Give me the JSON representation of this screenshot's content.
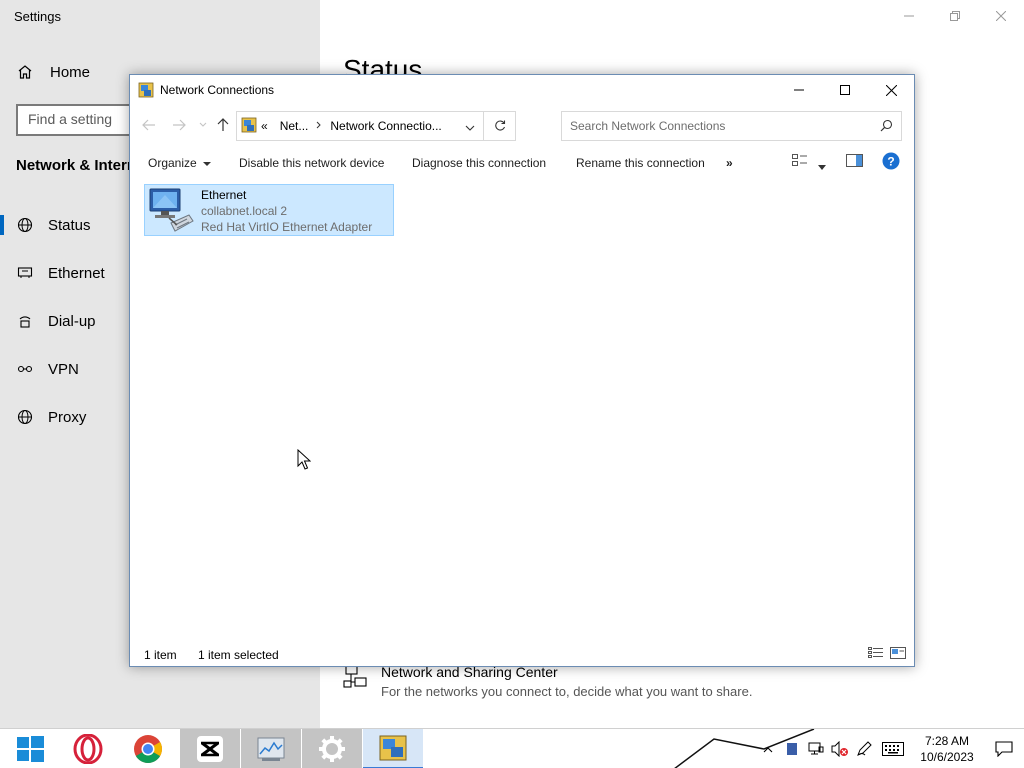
{
  "settings": {
    "title": "Settings",
    "home_label": "Home",
    "search_placeholder": "Find a setting",
    "section_title": "Network & Internet",
    "heading": "Status",
    "nav": [
      {
        "label": "Status",
        "icon": "globe-icon",
        "active": true
      },
      {
        "label": "Ethernet",
        "icon": "ethernet-icon"
      },
      {
        "label": "Dial-up",
        "icon": "dialup-icon"
      },
      {
        "label": "VPN",
        "icon": "vpn-icon"
      },
      {
        "label": "Proxy",
        "icon": "globe-icon"
      }
    ],
    "sharing_center": {
      "title": "Network and Sharing Center",
      "description": "For the networks you connect to, decide what you want to share."
    }
  },
  "explorer": {
    "title": "Network Connections",
    "address": {
      "overflow": "«",
      "segment1": "Net...",
      "segment2": "Network Connectio..."
    },
    "search_placeholder": "Search Network Connections",
    "commands": {
      "organize": "Organize",
      "disable": "Disable this network device",
      "diagnose": "Diagnose this connection",
      "rename": "Rename this connection",
      "more": "»"
    },
    "items": [
      {
        "name": "Ethernet",
        "network": "collabnet.local 2",
        "adapter": "Red Hat VirtIO Ethernet Adapter",
        "selected": true
      }
    ],
    "status": {
      "count": "1 item",
      "selected": "1 item selected"
    }
  },
  "taskbar": {
    "apps": [
      "start",
      "opera",
      "chrome",
      "capcut",
      "task-manager",
      "settings",
      "network-connections"
    ],
    "time": "7:28 AM",
    "date": "10/6/2023"
  },
  "colors": {
    "accent": "#0067c0",
    "selection_bg": "#cce8ff",
    "selection_border": "#99d1ff",
    "sidebar_bg": "#e6e6e6"
  }
}
